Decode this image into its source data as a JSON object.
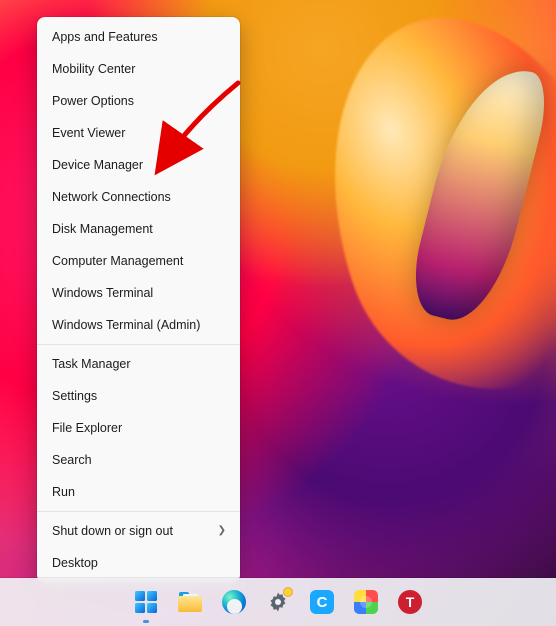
{
  "menu": {
    "group1": [
      {
        "label": "Apps and Features"
      },
      {
        "label": "Mobility Center"
      },
      {
        "label": "Power Options"
      },
      {
        "label": "Event Viewer"
      },
      {
        "label": "Device Manager"
      },
      {
        "label": "Network Connections"
      },
      {
        "label": "Disk Management"
      },
      {
        "label": "Computer Management"
      },
      {
        "label": "Windows Terminal"
      },
      {
        "label": "Windows Terminal (Admin)"
      }
    ],
    "group2": [
      {
        "label": "Task Manager"
      },
      {
        "label": "Settings"
      },
      {
        "label": "File Explorer"
      },
      {
        "label": "Search"
      },
      {
        "label": "Run"
      }
    ],
    "group3": [
      {
        "label": "Shut down or sign out",
        "submenu": true
      },
      {
        "label": "Desktop"
      }
    ]
  },
  "callout_target_label": "Device Manager",
  "taskbar": {
    "items": [
      {
        "name": "start",
        "letter": ""
      },
      {
        "name": "file-explorer",
        "letter": ""
      },
      {
        "name": "edge",
        "letter": ""
      },
      {
        "name": "settings",
        "letter": ""
      },
      {
        "name": "cortana",
        "letter": "C"
      },
      {
        "name": "multicolor",
        "letter": ""
      },
      {
        "name": "t-app",
        "letter": "T"
      }
    ]
  }
}
